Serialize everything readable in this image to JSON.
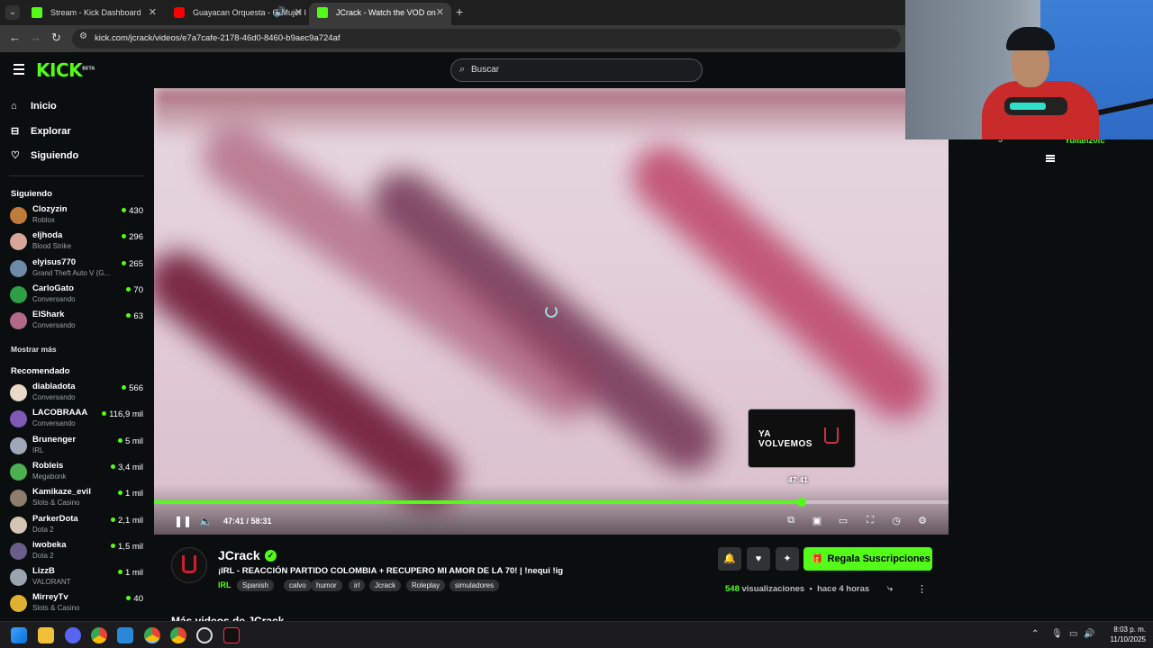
{
  "browser": {
    "tabs": [
      {
        "title": "Stream - Kick Dashboard",
        "favicon_color": "#53fc18"
      },
      {
        "title": "Guayacan Orquesta - 6. Mujer I",
        "favicon_color": "#ff0000"
      },
      {
        "title": "JCrack - Watch the VOD on",
        "favicon_color": "#53fc18",
        "active": true
      }
    ],
    "url": "kick.com/jcrack/videos/e7a7cafe-2178-46d0-8460-b9aec9a724af"
  },
  "header": {
    "logo": "KICK",
    "logo_badge": "BETA",
    "search_placeholder": "Buscar"
  },
  "sidebar": {
    "nav": [
      {
        "label": "Inicio",
        "icon": "home-icon"
      },
      {
        "label": "Explorar",
        "icon": "compass-icon"
      },
      {
        "label": "Siguiendo",
        "icon": "heart-icon"
      }
    ],
    "following_heading": "Siguiendo",
    "following": [
      {
        "name": "Clozyzin",
        "category": "Roblox",
        "viewers": "430",
        "avatar_color": "#c07a3a"
      },
      {
        "name": "eljhoda",
        "category": "Blood Strike",
        "viewers": "296",
        "avatar_color": "#d7a89a"
      },
      {
        "name": "elyisus770",
        "category": "Grand Theft Auto V (G...",
        "viewers": "265",
        "avatar_color": "#6d8aa8"
      },
      {
        "name": "CarloGato",
        "category": "Conversando",
        "viewers": "70",
        "avatar_color": "#2f9e44"
      },
      {
        "name": "ElShark",
        "category": "Conversando",
        "viewers": "63",
        "avatar_color": "#b36a8a"
      }
    ],
    "show_more": "Mostrar más",
    "recommended_heading": "Recomendado",
    "recommended": [
      {
        "name": "diabladota",
        "category": "Conversando",
        "viewers": "566",
        "avatar_color": "#e8d9c9"
      },
      {
        "name": "LACOBRAAA",
        "category": "Conversando",
        "viewers": "116,9 mil",
        "avatar_color": "#7d5ab5"
      },
      {
        "name": "Brunenger",
        "category": "IRL",
        "viewers": "5 mil",
        "avatar_color": "#a0a7b8"
      },
      {
        "name": "Robleis",
        "category": "Megabonk",
        "viewers": "3,4 mil",
        "avatar_color": "#4caf50"
      },
      {
        "name": "Kamikaze_evil",
        "category": "Slots & Casino",
        "viewers": "1 mil",
        "avatar_color": "#8d7d6d"
      },
      {
        "name": "ParkerDota",
        "category": "Dota 2",
        "viewers": "2,1 mil",
        "avatar_color": "#d4c5b5"
      },
      {
        "name": "iwobeka",
        "category": "Dota 2",
        "viewers": "1,5 mil",
        "avatar_color": "#6b5d8a"
      },
      {
        "name": "LizzB",
        "category": "VALORANT",
        "viewers": "1 mil",
        "avatar_color": "#9aa5b0"
      },
      {
        "name": "MirreyTv",
        "category": "Slots & Casino",
        "viewers": "40",
        "avatar_color": "#e0b030"
      }
    ]
  },
  "player": {
    "current_time": "47:41",
    "duration": "58:31",
    "progress_fraction": 0.815,
    "preview_time": "47:41",
    "preview_text_line1": "YA",
    "preview_text_line2": "VOLVEMOS"
  },
  "video": {
    "channel_name": "JCrack",
    "title": "¡IRL -  REACCIÓN PARTIDO COLOMBIA + RECUPERO MI AMOR DE LA 70! | !nequi !ig",
    "category": "IRL",
    "tags": [
      "Spanish",
      "calvo",
      "humor",
      "irl",
      "Jcrack",
      "Roleplay",
      "simuladores"
    ],
    "gift_button": "Regala Suscripciones",
    "views_count": "548",
    "views_label": "visualizaciones",
    "age": "hace 4 horas",
    "more_videos_heading": "Más videos de JCrack"
  },
  "chat": {
    "count": "5",
    "user": "Yulian20fc"
  },
  "taskbar": {
    "time": "8:03 p. m.",
    "date": "11/10/2025"
  },
  "colors": {
    "kick_green": "#53fc18",
    "background": "#0b0e0f"
  }
}
